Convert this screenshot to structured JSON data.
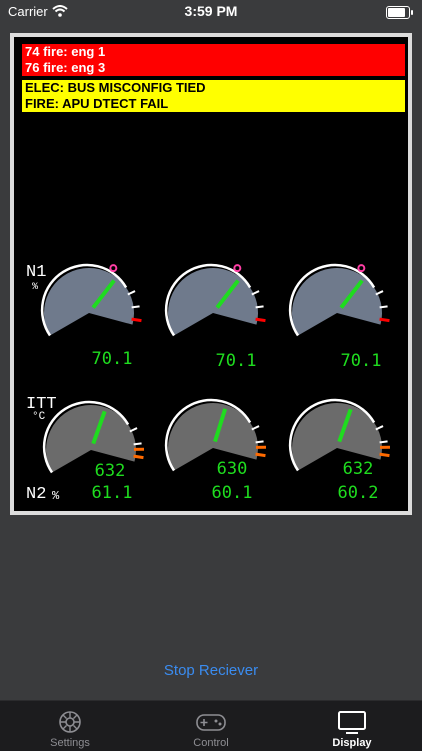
{
  "status_bar": {
    "carrier": "Carrier",
    "time": "3:59 PM"
  },
  "messages": {
    "warnings": [
      "74 fire: eng 1",
      "76 fire: eng 3"
    ],
    "cautions": [
      "ELEC: BUS MISCONFIG TIED",
      "FIRE: APU DTECT FAIL"
    ]
  },
  "gauges": {
    "n1": {
      "label": "N1",
      "unit": "%",
      "values": [
        "70.1",
        "70.1",
        "70.1"
      ],
      "levels_percent": [
        70.1,
        70.1,
        70.1
      ]
    },
    "itt": {
      "label": "ITT",
      "unit": "°C",
      "values": [
        "632",
        "630",
        "632"
      ],
      "levels_fraction": [
        0.62,
        0.61,
        0.62
      ]
    },
    "n2": {
      "label": "N2",
      "unit": "%",
      "values": [
        "61.1",
        "60.1",
        "60.2"
      ]
    }
  },
  "colors": {
    "warning": "#ff0000",
    "caution": "#ffff00",
    "readout": "#1fdc1f",
    "needle": "#1fdc1f",
    "limit_red": "#ff0000",
    "limit_amber": "#ff6a00",
    "marker_magenta": "#ff3ea5"
  },
  "actions": {
    "stop_receiver": "Stop Reciever"
  },
  "tabs": [
    {
      "label": "Settings",
      "icon": "settings-gear-icon",
      "active": false
    },
    {
      "label": "Control",
      "icon": "gamepad-icon",
      "active": false
    },
    {
      "label": "Display",
      "icon": "display-monitor-icon",
      "active": true
    }
  ]
}
